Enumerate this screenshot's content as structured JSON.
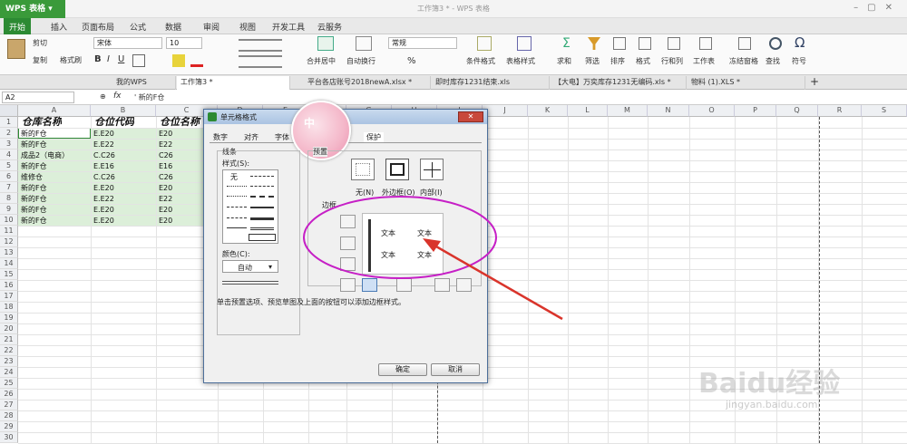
{
  "app": {
    "name": "WPS 表格",
    "window_title": "工作簿3 * - WPS 表格"
  },
  "menu_tabs": [
    "开始",
    "插入",
    "页面布局",
    "公式",
    "数据",
    "审阅",
    "视图",
    "开发工具",
    "云服务"
  ],
  "ribbon": {
    "cut": "剪切",
    "copy": "复制",
    "format_painter": "格式刷",
    "paste_icon": "paste-icon",
    "font_name": "宋体",
    "font_size": "10",
    "number_format": "常规",
    "merge": "合并居中",
    "wrap": "自动换行",
    "percent": "%",
    "cond_format": "条件格式",
    "table_style": "表格样式",
    "sum": "求和",
    "filter": "筛选",
    "sort": "排序",
    "format": "格式",
    "rows_cols": "行和列",
    "sheet": "工作表",
    "freeze": "冻结窗格",
    "find": "查找",
    "symbol": "符号"
  },
  "doc_tabs": [
    "我的WPS",
    "工作簿3 *",
    "平台各店账号2018newA.xlsx *",
    "即时库存1231结束.xls",
    "【大电】万奕库存1231无编码.xls *",
    "物料 (1).XLS *"
  ],
  "formula_bar": {
    "name_box": "A2",
    "fx": "fx",
    "content": "' 新的F仓"
  },
  "columns": [
    "A",
    "B",
    "C",
    "D",
    "E",
    "F",
    "G",
    "H",
    "I",
    "J",
    "K",
    "L",
    "M",
    "N",
    "O",
    "P",
    "Q",
    "R",
    "S"
  ],
  "rows": [
    "1",
    "2",
    "3",
    "4",
    "5",
    "6",
    "7",
    "8",
    "9",
    "10",
    "11",
    "12",
    "13",
    "14",
    "15",
    "16",
    "17",
    "18",
    "19",
    "20",
    "21",
    "22",
    "23",
    "24",
    "25",
    "26",
    "27",
    "28",
    "29",
    "30"
  ],
  "table": {
    "headers": [
      "仓库名称",
      "仓位代码",
      "仓位名称"
    ],
    "rows": [
      [
        "新的F仓",
        "E.E20",
        "E20"
      ],
      [
        "新的F仓",
        "E.E22",
        "E22"
      ],
      [
        "成品2（电商）",
        "C.C26",
        "C26"
      ],
      [
        "新的F仓",
        "E.E16",
        "E16"
      ],
      [
        "维修仓",
        "C.C26",
        "C26"
      ],
      [
        "新的F仓",
        "E.E20",
        "E20"
      ],
      [
        "新的F仓",
        "E.E22",
        "E22"
      ],
      [
        "新的F仓",
        "E.E20",
        "E20"
      ],
      [
        "新的F仓",
        "E.E20",
        "E20"
      ]
    ]
  },
  "dialog": {
    "title": "单元格格式",
    "tabs": [
      "数字",
      "对齐",
      "字体",
      "图案",
      "保护"
    ],
    "ime_badge": "中",
    "line_group": "线条",
    "style_label": "样式(S):",
    "style_none": "无",
    "color_label": "颜色(C):",
    "color_value": "自动",
    "preset_label": "预置",
    "presets": [
      "无(N)",
      "外边框(O)",
      "内部(I)"
    ],
    "border_label": "边框",
    "preview_text": [
      "文本",
      "文本",
      "文本",
      "文本"
    ],
    "hint": "单击预置选项、预览草图及上面的按钮可以添加边框样式。",
    "ok": "确定",
    "cancel": "取消"
  },
  "watermark": {
    "brand": "Baidu经验",
    "url": "jingyan.baidu.com"
  },
  "colors": {
    "wps_green": "#2c8a33",
    "selection": "#dcefd9",
    "annotation": "#c61fc6",
    "arrow": "#d9342b"
  }
}
